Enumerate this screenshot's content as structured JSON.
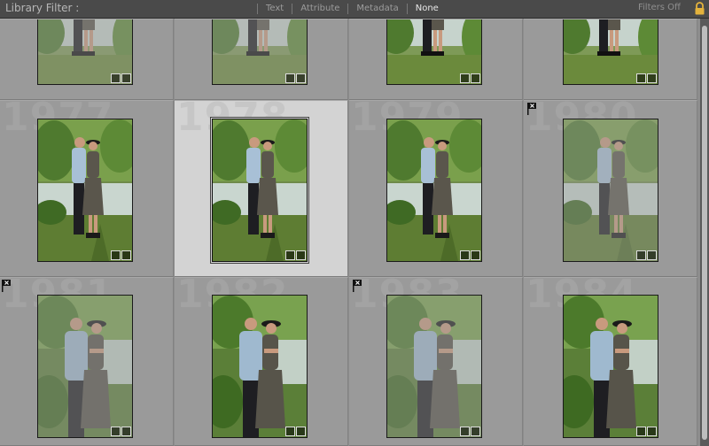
{
  "filter_bar": {
    "title": "Library Filter :",
    "tabs": [
      {
        "label": "Text",
        "active": false
      },
      {
        "label": "Attribute",
        "active": false
      },
      {
        "label": "Metadata",
        "active": false
      },
      {
        "label": "None",
        "active": true
      }
    ],
    "filters_status": "Filters Off",
    "lock_icon": "lock-icon"
  },
  "grid": {
    "rows": [
      {
        "cells": [
          {
            "index": "",
            "rejected": false,
            "selected": false,
            "dimmed": true
          },
          {
            "index": "",
            "rejected": false,
            "selected": false,
            "dimmed": true
          },
          {
            "index": "",
            "rejected": false,
            "selected": false,
            "dimmed": false
          },
          {
            "index": "",
            "rejected": false,
            "selected": false,
            "dimmed": false
          }
        ]
      },
      {
        "cells": [
          {
            "index": "1977",
            "rejected": false,
            "selected": false,
            "dimmed": false
          },
          {
            "index": "1978",
            "rejected": false,
            "selected": true,
            "dimmed": false
          },
          {
            "index": "1979",
            "rejected": false,
            "selected": false,
            "dimmed": false
          },
          {
            "index": "1980",
            "rejected": true,
            "selected": false,
            "dimmed": true
          }
        ]
      },
      {
        "cells": [
          {
            "index": "1981",
            "rejected": true,
            "selected": false,
            "dimmed": true
          },
          {
            "index": "1982",
            "rejected": false,
            "selected": false,
            "dimmed": false
          },
          {
            "index": "1983",
            "rejected": true,
            "selected": false,
            "dimmed": true
          },
          {
            "index": "1984",
            "rejected": false,
            "selected": false,
            "dimmed": false
          }
        ]
      }
    ]
  },
  "colors": {
    "panel": "#9a9a9a",
    "selected_cell": "#d3d3d3",
    "toolbar": "#4a4a4a",
    "lock_accent": "#e3b23c"
  }
}
